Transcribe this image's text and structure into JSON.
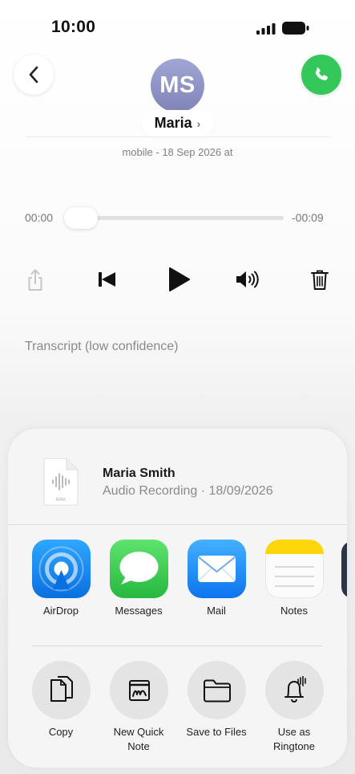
{
  "status": {
    "time": "10:00"
  },
  "contact": {
    "initials": "MS",
    "name": "Maria",
    "subtitle": "mobile - 18 Sep 2026 at"
  },
  "player": {
    "elapsed": "00:00",
    "remaining": "-00:09",
    "progress_fraction": 0.0
  },
  "transcript": {
    "label": "Transcript (low confidence)"
  },
  "share_sheet": {
    "file": {
      "title": "Maria Smith",
      "subtitle": "Audio Recording · 18/09/2026",
      "icon_caption": "M4A"
    },
    "apps": [
      {
        "label": "AirDrop",
        "icon": "airdrop-icon",
        "color": "#1e8cf5"
      },
      {
        "label": "Messages",
        "icon": "messages-icon",
        "color": "#34c759"
      },
      {
        "label": "Mail",
        "icon": "mail-icon",
        "color": "#1a8cff"
      },
      {
        "label": "Notes",
        "icon": "notes-icon",
        "color": "#ffd60a"
      }
    ],
    "actions": [
      {
        "label": "Copy",
        "icon": "copy-icon"
      },
      {
        "label": "New Quick\nNote",
        "icon": "quick-note-icon"
      },
      {
        "label": "Save to Files",
        "icon": "folder-icon"
      },
      {
        "label": "Use as\nRingtone",
        "icon": "bell-icon"
      }
    ]
  },
  "colors": {
    "call_green": "#34c759",
    "avatar": "#9096c8"
  }
}
